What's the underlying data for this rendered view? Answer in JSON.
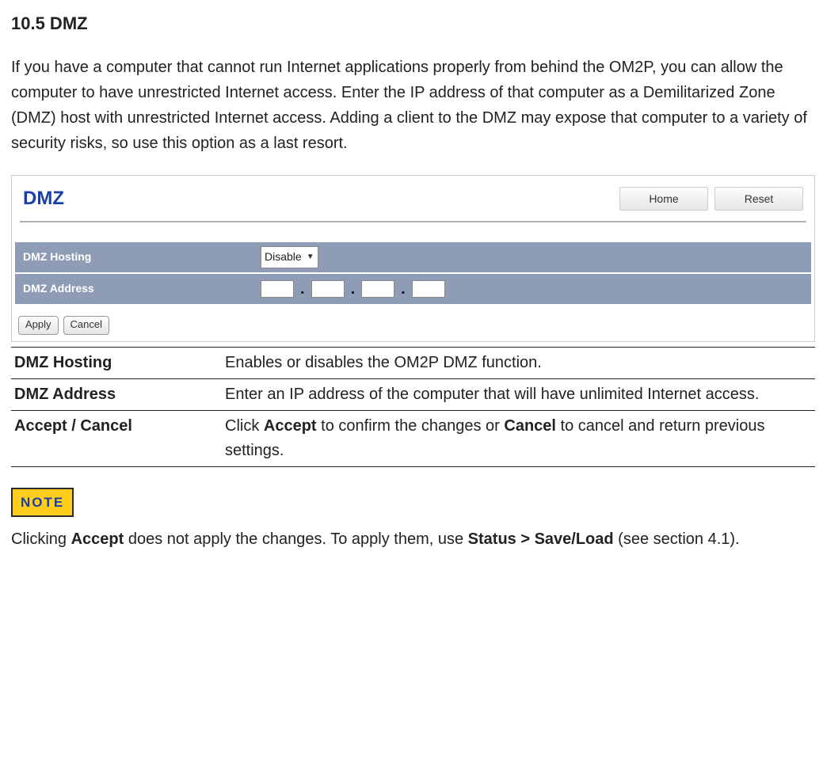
{
  "section_title": "10.5 DMZ",
  "intro": "If you have a computer that cannot run Internet applications properly from behind the OM2P, you can allow the computer to have unrestricted Internet access. Enter the IP address of that computer as a Demilitarized Zone (DMZ) host with unrestricted Internet access. Adding a client to the DMZ may expose that computer to a variety of security risks, so use this option as a last resort.",
  "panel": {
    "title": "DMZ",
    "home_btn": "Home",
    "reset_btn": "Reset",
    "row_hosting_label": "DMZ Hosting",
    "hosting_value": "Disable",
    "row_address_label": "DMZ Address",
    "ip": {
      "a": "",
      "b": "",
      "c": "",
      "d": ""
    },
    "apply_btn": "Apply",
    "cancel_btn": "Cancel"
  },
  "defs": {
    "r1_term": "DMZ Hosting",
    "r1_desc": "Enables or disables the OM2P DMZ function.",
    "r2_term": "DMZ Address",
    "r2_desc": "Enter an IP address of the computer that will have unlimited Internet access.",
    "r3_term": "Accept / Cancel",
    "r3_pre": "Click ",
    "r3_b1": "Accept",
    "r3_mid": " to confirm the changes or ",
    "r3_b2": "Cancel",
    "r3_post": " to cancel and return previous settings."
  },
  "note": {
    "badge": "NOTE",
    "pre": "Clicking ",
    "b1": "Accept",
    "mid": " does not apply the changes. To apply them, use ",
    "b2": "Status > Save/Load",
    "post": " (see section 4.1)."
  }
}
